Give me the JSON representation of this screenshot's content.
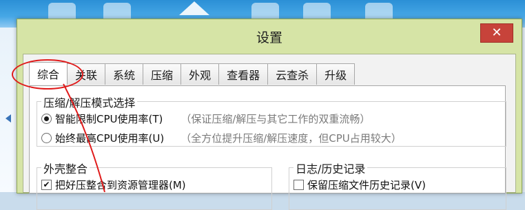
{
  "dialog": {
    "title": "设置",
    "close_label": "✕"
  },
  "tabs": [
    {
      "label": "综合",
      "active": true
    },
    {
      "label": "关联",
      "active": false
    },
    {
      "label": "系统",
      "active": false
    },
    {
      "label": "压缩",
      "active": false
    },
    {
      "label": "外观",
      "active": false
    },
    {
      "label": "查看器",
      "active": false
    },
    {
      "label": "云查杀",
      "active": false
    },
    {
      "label": "升级",
      "active": false
    }
  ],
  "mode_group": {
    "title": "压缩/解压模式选择",
    "options": [
      {
        "label": "智能限制CPU使用率(T)",
        "hint": "（保证压缩/解压与其它工作的双重流畅）",
        "checked": true
      },
      {
        "label": "始终最高CPU使用率(U)",
        "hint": "（全方位提升压缩/解压速度，但CPU占用较大）",
        "checked": false
      }
    ]
  },
  "shell_group": {
    "title": "外壳整合",
    "option": {
      "label": "把好压整合到资源管理器(M)",
      "checked": true
    }
  },
  "log_group": {
    "title": "日志/历史记录",
    "option": {
      "label": "保留压缩文件历史记录(V)",
      "checked": false
    }
  },
  "colors": {
    "dialog_frame": "#d6e4a6",
    "close_button": "#c7433a",
    "annotation": "#e01a1a"
  }
}
